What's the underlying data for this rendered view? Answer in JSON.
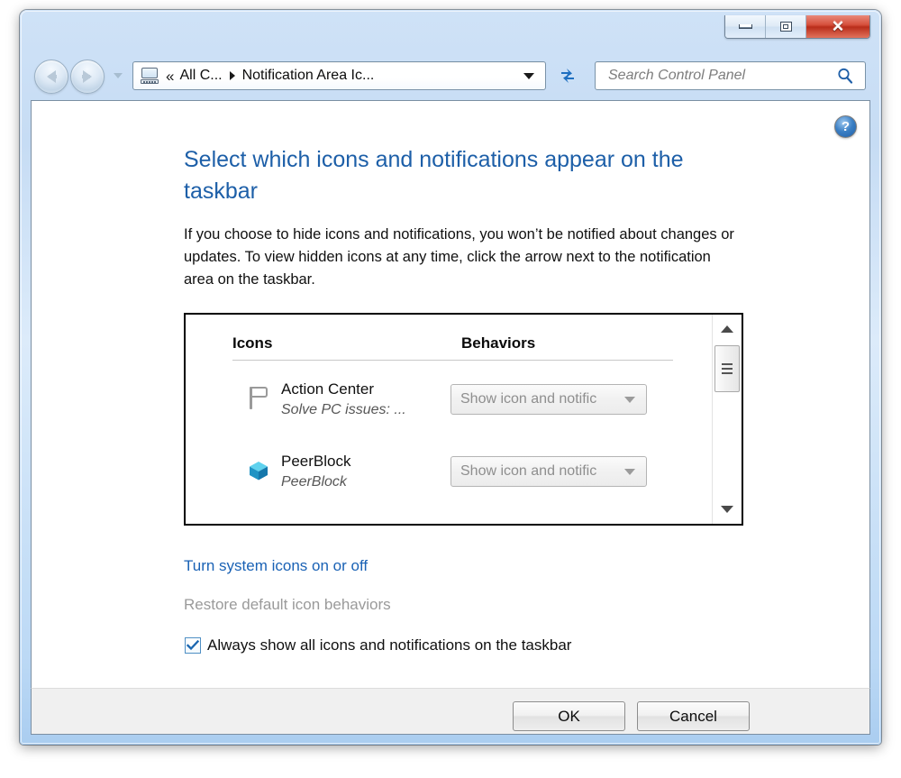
{
  "window": {
    "caption_buttons": [
      {
        "name": "minimize",
        "label": "Minimize"
      },
      {
        "name": "maximize",
        "label": "Maximize"
      },
      {
        "name": "close",
        "label": "Close",
        "glyph": "✕"
      }
    ]
  },
  "navbar": {
    "back_label": "Back",
    "forward_label": "Forward",
    "recent_pages_label": "Recent pages",
    "address": {
      "icon": "control-panel-icon",
      "separator_double": "«",
      "crumbs": [
        "All C...",
        "Notification Area Ic..."
      ],
      "dropdown_label": "Previous locations"
    },
    "refresh_label": "Refresh",
    "search": {
      "placeholder": "Search Control Panel",
      "value": "",
      "icon": "search-icon"
    }
  },
  "content": {
    "help_label": "?",
    "page_title": "Select which icons and notifications appear on the taskbar",
    "page_description": "If you choose to hide icons and notifications, you won’t be notified about changes or updates. To view hidden icons at any time, click the arrow next to the notification area on the taskbar.",
    "list": {
      "headers": {
        "icons": "Icons",
        "behaviors": "Behaviors"
      },
      "rows": [
        {
          "icon": "flag-icon",
          "title": "Action Center",
          "subtitle": "Solve PC issues: ...",
          "behavior": "Show icon and notific"
        },
        {
          "icon": "cube-icon",
          "title": "PeerBlock",
          "subtitle": "PeerBlock",
          "behavior": "Show icon and notific"
        }
      ],
      "scrollbar": {
        "up_label": "Scroll up",
        "down_label": "Scroll down",
        "thumb_label": "Scroll thumb"
      }
    },
    "link_system_icons": "Turn system icons on or off",
    "link_restore_defaults": "Restore default icon behaviors",
    "checkbox": {
      "label": "Always show all icons and notifications on the taskbar",
      "checked": true
    }
  },
  "footer": {
    "ok_label": "OK",
    "cancel_label": "Cancel"
  },
  "colors": {
    "title_link": "#1d5fa8",
    "link": "#1a62b5",
    "disabled_link": "#9a9a9a",
    "glass": "#cfe2f7",
    "close_button": "#d6503c",
    "check_mark": "#1a66b0",
    "peerblock_cube": "#2aa8d4"
  }
}
